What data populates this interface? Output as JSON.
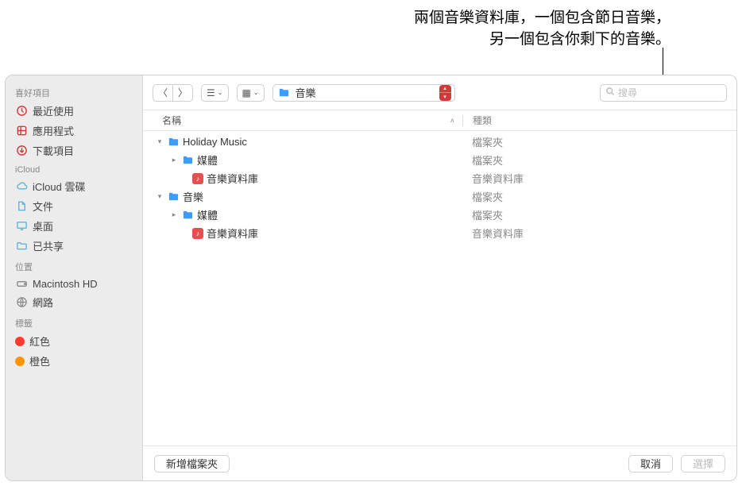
{
  "annotation": {
    "line1": "兩個音樂資料庫，一個包含節日音樂，",
    "line2": "另一個包含你剩下的音樂。"
  },
  "sidebar": {
    "sections": {
      "favorites": "喜好項目",
      "icloud": "iCloud",
      "locations": "位置",
      "tags": "標籤"
    },
    "items": {
      "recents": "最近使用",
      "applications": "應用程式",
      "downloads": "下載項目",
      "icloud_drive": "iCloud 雲碟",
      "documents": "文件",
      "desktop": "桌面",
      "shared": "已共享",
      "macintosh_hd": "Macintosh HD",
      "network": "網路",
      "red": "紅色",
      "orange": "橙色"
    }
  },
  "toolbar": {
    "path_label": "音樂",
    "search_placeholder": "搜尋"
  },
  "columns": {
    "name": "名稱",
    "kind": "種類"
  },
  "rows": [
    {
      "indent": 0,
      "disclosure": "▾",
      "icon": "folder",
      "name": "Holiday Music",
      "kind": "檔案夾"
    },
    {
      "indent": 1,
      "disclosure": "▸",
      "icon": "folder",
      "name": "媒體",
      "kind": "檔案夾"
    },
    {
      "indent": 2,
      "disclosure": "",
      "icon": "library",
      "name": "音樂資料庫",
      "kind": "音樂資料庫"
    },
    {
      "indent": 0,
      "disclosure": "▾",
      "icon": "folder",
      "name": "音樂",
      "kind": "檔案夾"
    },
    {
      "indent": 1,
      "disclosure": "▸",
      "icon": "folder",
      "name": "媒體",
      "kind": "檔案夾"
    },
    {
      "indent": 2,
      "disclosure": "",
      "icon": "library",
      "name": "音樂資料庫",
      "kind": "音樂資料庫"
    }
  ],
  "footer": {
    "new_folder": "新增檔案夾",
    "cancel": "取消",
    "choose": "選擇"
  },
  "tag_colors": {
    "red": "#ff3b30",
    "orange": "#ff9500"
  }
}
